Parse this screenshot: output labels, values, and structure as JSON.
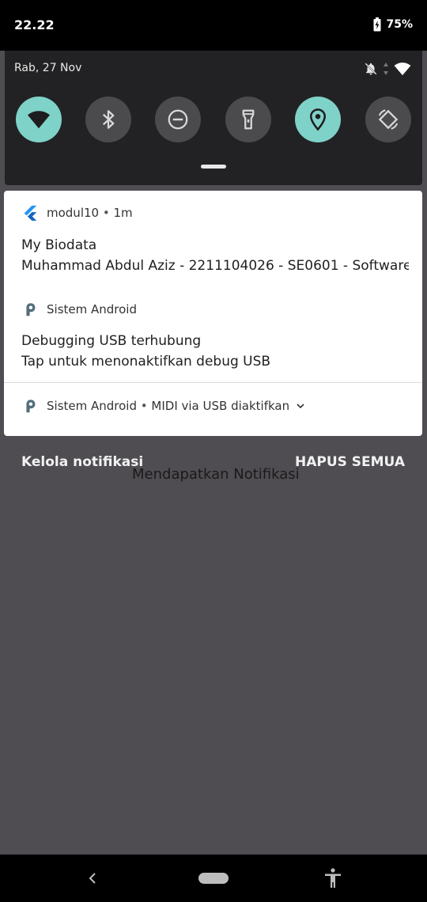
{
  "status_bar": {
    "time": "22.22",
    "battery_percent": "75%",
    "battery_level": 0.75
  },
  "quick_settings": {
    "date": "Rab, 27 Nov",
    "tiles": [
      {
        "name": "wifi",
        "icon": "wifi-icon",
        "state": "on"
      },
      {
        "name": "bluetooth",
        "icon": "bluetooth-icon",
        "state": "off"
      },
      {
        "name": "do-not-disturb",
        "icon": "dnd-icon",
        "state": "off"
      },
      {
        "name": "flashlight",
        "icon": "flashlight-icon",
        "state": "off"
      },
      {
        "name": "location",
        "icon": "location-icon",
        "state": "on"
      },
      {
        "name": "auto-rotate",
        "icon": "auto-rotate-icon",
        "state": "off"
      }
    ],
    "active_color": "#7fd2c8",
    "inactive_color": "#4b4b4e"
  },
  "notifications": {
    "n1": {
      "app": "modul10",
      "time": "1m",
      "title": "My Biodata",
      "text": "Muhammad Abdul Aziz - 2211104026 - SE0601 - Software..",
      "icon": "flutter-icon"
    },
    "n2": {
      "app": "Sistem Android",
      "title": "Debugging USB terhubung",
      "text": "Tap untuk menonaktifkan debug USB",
      "icon": "android-system-icon"
    },
    "n3": {
      "app": "Sistem Android",
      "summary": "MIDI via USB diaktifkan",
      "icon": "android-system-icon"
    }
  },
  "shade": {
    "manage_label": "Kelola notifikasi",
    "clear_all_label": "HAPUS SEMUA",
    "overlay_text": "Mendapatkan Notifikasi"
  },
  "nav_bar": {
    "back_icon": "back-icon",
    "home_icon": "home-pill-icon",
    "accessibility_icon": "accessibility-icon"
  }
}
